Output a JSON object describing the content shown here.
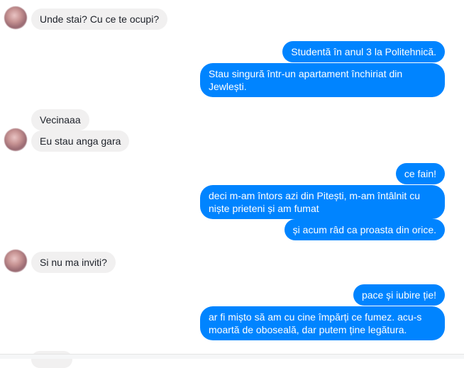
{
  "messages": [
    {
      "id": "m1",
      "text": "Unde stai? Cu ce te ocupi?"
    },
    {
      "id": "m2",
      "text": "Studentă în anul 3 la Politehnică."
    },
    {
      "id": "m3",
      "text": "Stau singură într-un apartament închiriat din Jewlești."
    },
    {
      "id": "m4",
      "text": "Vecinaaa"
    },
    {
      "id": "m5",
      "text": "Eu stau anga gara"
    },
    {
      "id": "m6",
      "text": "ce fain!"
    },
    {
      "id": "m7",
      "text": "deci m-am întors azi din Pitești, m-am întâlnit cu niște prieteni și am fumat"
    },
    {
      "id": "m8",
      "text": "și acum râd ca proasta din orice."
    },
    {
      "id": "m9",
      "text": "Si nu ma inviti?"
    },
    {
      "id": "m10",
      "text": "pace și iubire ție!"
    },
    {
      "id": "m11",
      "text": "ar fi mișto să am cu cine împărți ce fumez. acu-s moartă de oboseală, dar putem ține legătura."
    }
  ],
  "colors": {
    "outgoing_bubble": "#0084ff",
    "incoming_bubble": "#f1f0f0",
    "incoming_text": "#1d2129",
    "outgoing_text": "#ffffff"
  }
}
